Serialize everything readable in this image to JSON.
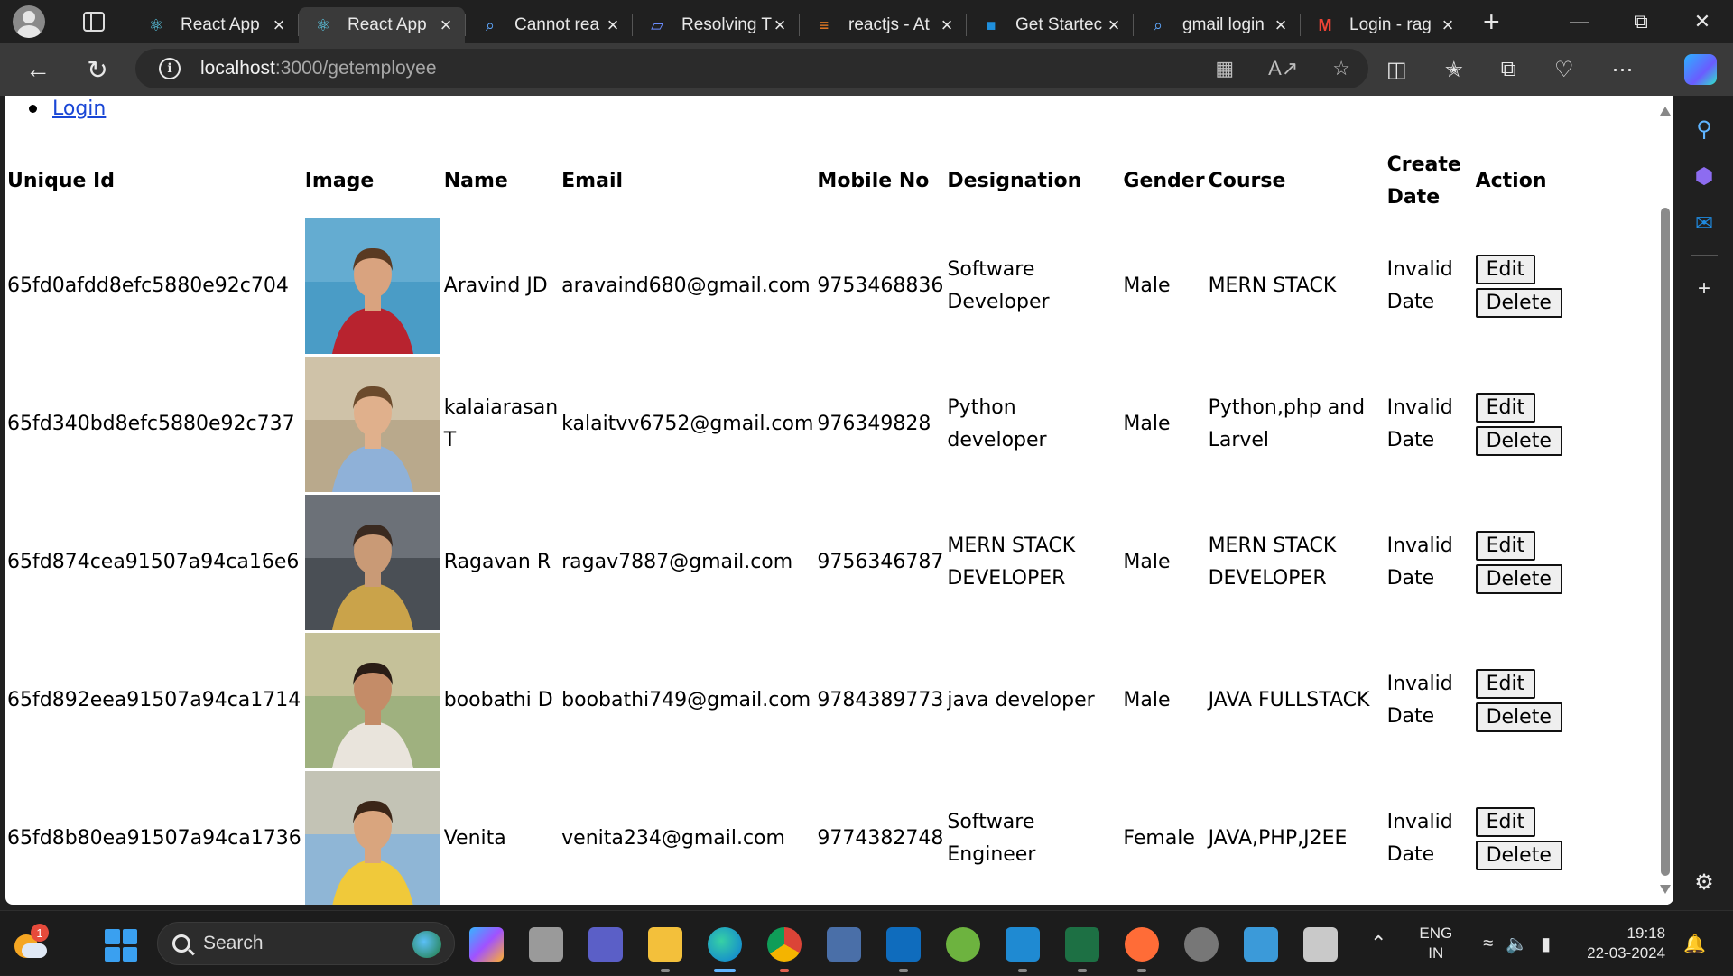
{
  "browser": {
    "tabs": [
      {
        "title": "React App",
        "icon": "react-icon",
        "active": false
      },
      {
        "title": "React App",
        "icon": "react-icon",
        "active": true
      },
      {
        "title": "Cannot rea",
        "icon": "search-icon",
        "active": false
      },
      {
        "title": "Resolving T",
        "icon": "stackblitz-icon",
        "active": false
      },
      {
        "title": "reactjs - At",
        "icon": "stackoverflow-icon",
        "active": false
      },
      {
        "title": "Get Startec",
        "icon": "sap-icon",
        "active": false
      },
      {
        "title": "gmail login",
        "icon": "search-icon",
        "active": false
      },
      {
        "title": "Login - rag",
        "icon": "gmail-icon",
        "active": false
      }
    ],
    "url_host": "localhost",
    "url_path": ":3000/getemployee"
  },
  "page": {
    "login_link": "Login",
    "columns": [
      "Unique Id",
      "Image",
      "Name",
      "Email",
      "Mobile No",
      "Designation",
      "Gender",
      "Course",
      "Create Date",
      "Action"
    ],
    "edit_label": "Edit",
    "delete_label": "Delete",
    "rows": [
      {
        "id": "65fd0afdd8efc5880e92c704",
        "name": "Aravind JD",
        "email": "aravaind680@gmail.com",
        "mobile": "9753468836",
        "designation": "Software Developer",
        "gender": "Male",
        "course": "MERN STACK",
        "create_date": "Invalid Date",
        "photo": {
          "bg": "#4a9cc6",
          "bg2": "#6fb3d6",
          "shirt": "#b8232f",
          "skin": "#d9a37f",
          "hair": "#5a3a22"
        }
      },
      {
        "id": "65fd340bd8efc5880e92c737",
        "name": "kalaiarasan T",
        "email": "kalaitvv6752@gmail.com",
        "mobile": "976349828",
        "designation": "Python developer",
        "gender": "Male",
        "course": "Python,php and Larvel",
        "create_date": "Invalid Date",
        "photo": {
          "bg": "#b9a98c",
          "bg2": "#d8cdb4",
          "shirt": "#8fb1d8",
          "skin": "#e0b08c",
          "hair": "#6b4a2c"
        }
      },
      {
        "id": "65fd874cea91507a94ca16e6",
        "name": "Ragavan R",
        "email": "ragav7887@gmail.com",
        "mobile": "9756346787",
        "designation": "MERN STACK DEVELOPER",
        "gender": "Male",
        "course": "MERN STACK DEVELOPER",
        "create_date": "Invalid Date",
        "photo": {
          "bg": "#4a4f55",
          "bg2": "#7b8088",
          "shirt": "#caa34a",
          "skin": "#c99a76",
          "hair": "#3a2a20"
        }
      },
      {
        "id": "65fd892eea91507a94ca1714",
        "name": "boobathi D",
        "email": "boobathi749@gmail.com",
        "mobile": "9784389773",
        "designation": "java developer",
        "gender": "Male",
        "course": "JAVA FULLSTACK",
        "create_date": "Invalid Date",
        "photo": {
          "bg": "#9fb17f",
          "bg2": "#d6c7a4",
          "shirt": "#e9e4dc",
          "skin": "#c48c68",
          "hair": "#2a1d16"
        }
      },
      {
        "id": "65fd8b80ea91507a94ca1736",
        "name": "Venita",
        "email": "venita234@gmail.com",
        "mobile": "9774382748",
        "designation": "Software Engineer",
        "gender": "Female",
        "course": "JAVA,PHP,J2EE",
        "create_date": "Invalid Date",
        "photo": {
          "bg": "#8fb6d6",
          "bg2": "#d9c9a6",
          "shirt": "#f0c93a",
          "skin": "#d9a57e",
          "hair": "#3b2618"
        }
      }
    ]
  },
  "taskbar": {
    "weather_badge": "1",
    "search_label": "Search",
    "lang_line1": "ENG",
    "lang_line2": "IN",
    "time": "19:18",
    "date": "22-03-2024"
  },
  "colors": {
    "link": "#1a47d6",
    "chrome_bg": "#202020",
    "toolbar_bg": "#3a3a3a"
  }
}
